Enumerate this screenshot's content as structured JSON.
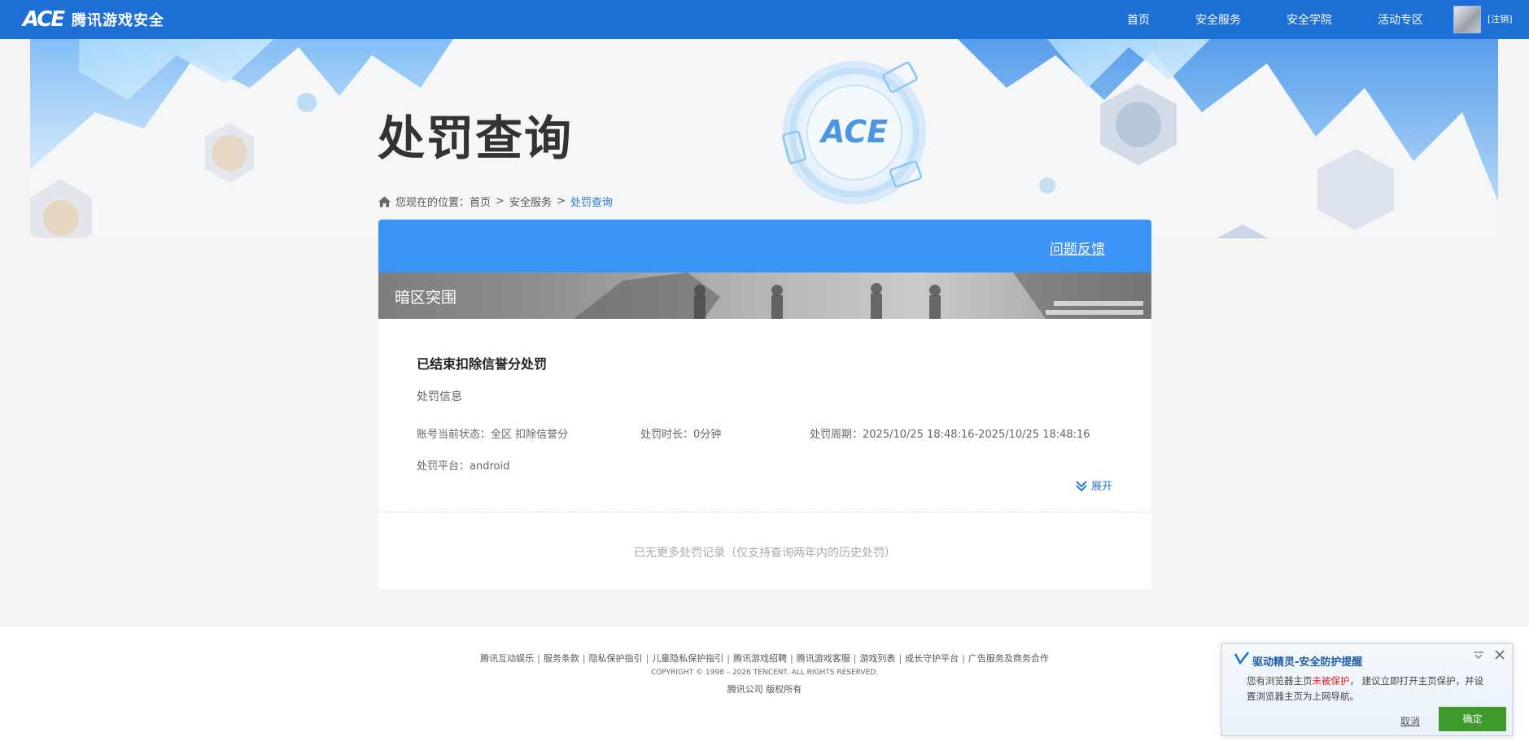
{
  "header": {
    "logo_mark": "ACE",
    "logo_text": "腾讯游戏安全",
    "nav": [
      "首页",
      "安全服务",
      "安全学院",
      "活动专区"
    ],
    "logout": "[注销]"
  },
  "page": {
    "title": "处罚查询",
    "breadcrumb": {
      "prefix": "您现在的位置：",
      "items": [
        "首页",
        "安全服务",
        "处罚查询"
      ],
      "separator": ">"
    }
  },
  "card": {
    "feedback": "问题反馈",
    "game_name": "暗区突围",
    "record": {
      "title": "已结束扣除信誉分处罚",
      "section_label": "处罚信息",
      "status": "账号当前状态：全区 扣除信誉分",
      "duration": "处罚时长：0分钟",
      "period": "处罚周期：2025/10/25 18:48:16-2025/10/25 18:48:16",
      "platform": "处罚平台：android"
    },
    "expand_label": "展开",
    "no_more": "已无更多处罚记录（仅支持查询两年内的历史处罚）"
  },
  "footer": {
    "links": [
      "腾讯互动娱乐",
      "服务条款",
      "隐私保护指引",
      "儿童隐私保护指引",
      "腾讯游戏招聘",
      "腾讯游戏客服",
      "游戏列表",
      "成长守护平台",
      "广告服务及商务合作"
    ],
    "separator": "|",
    "copyright": "COPYRIGHT © 1998 – 2026 TENCENT. ALL RIGHTS RESERVED.",
    "company": "腾讯公司 版权所有"
  },
  "popup": {
    "title": "驱动精灵-安全防护提醒",
    "msg_before": "您有浏览器主页",
    "msg_warn": "未被保护",
    "msg_after": "， 建议立即打开主页保护，并设置浏览器主页为上网导航。",
    "cancel": "取消",
    "ok": "确定"
  },
  "colors": {
    "nav_bg": "#1d6fd6",
    "card_header": "#3b93f5",
    "accent_link": "#2a7ad6",
    "warn": "#e02020",
    "ok_button": "#3e9a2a"
  },
  "icons": [
    "home-icon",
    "ace-emblem-icon",
    "double-chevron-down-icon",
    "popup-logo-icon",
    "minimize-icon",
    "close-icon"
  ]
}
